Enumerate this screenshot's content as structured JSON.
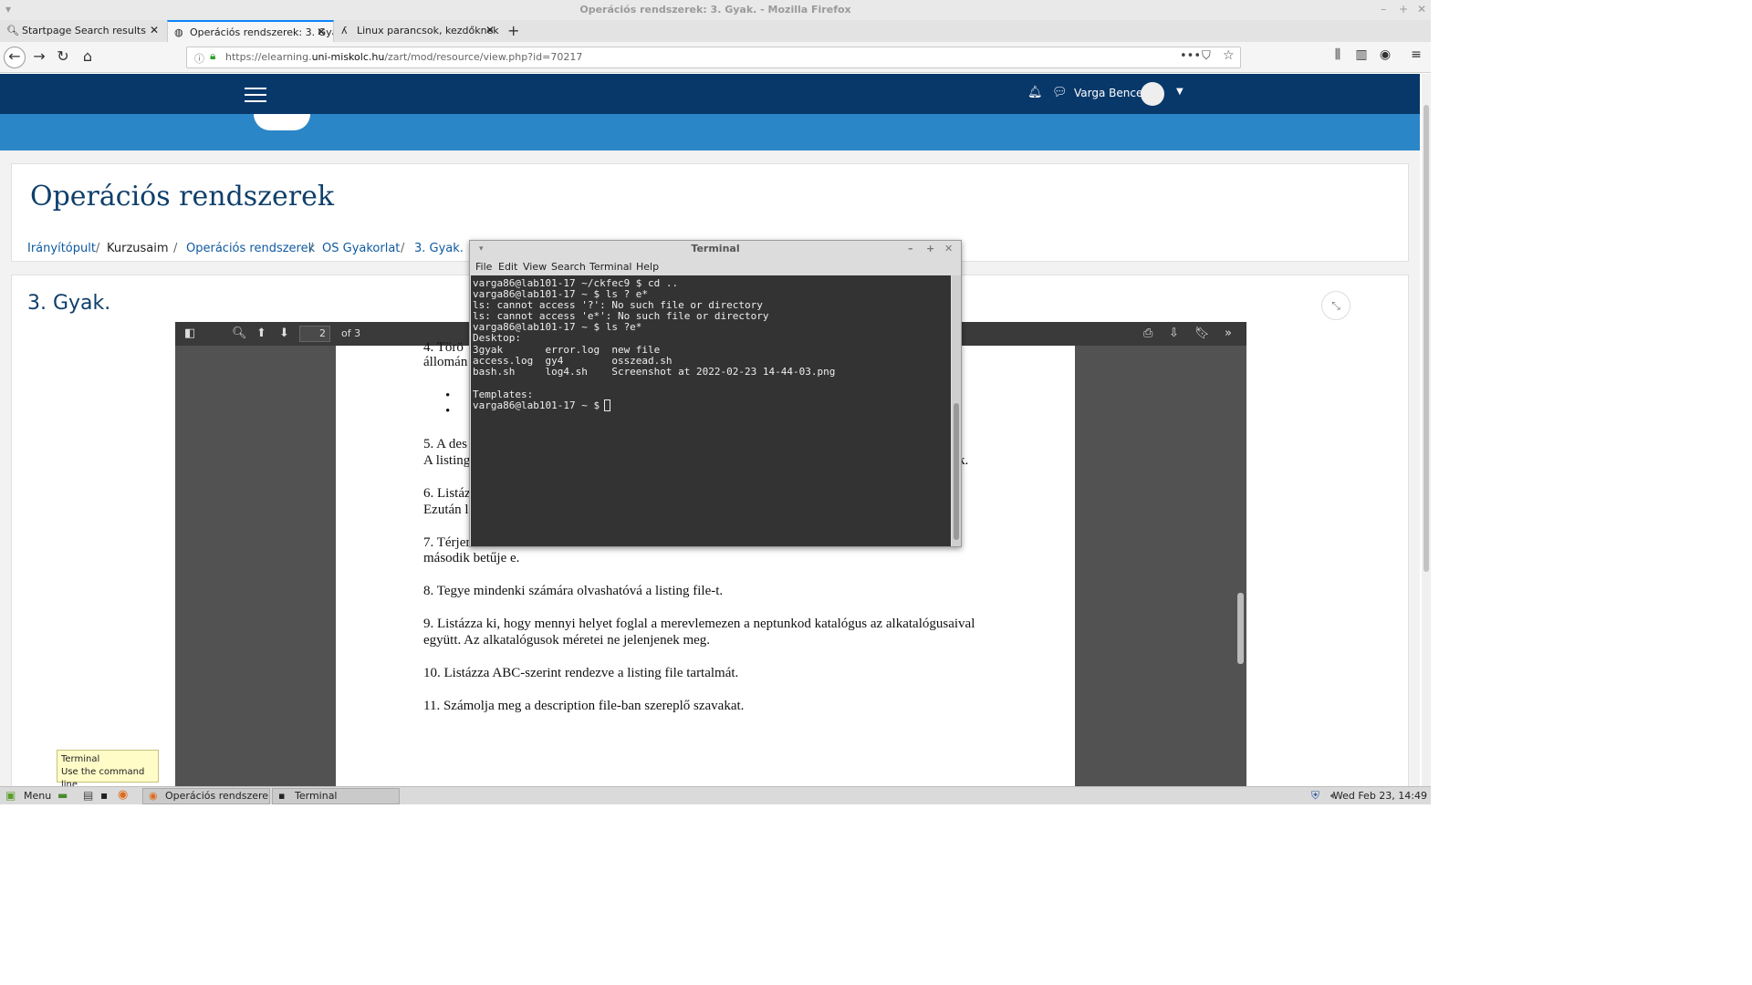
{
  "window": {
    "title": "Operációs rendszerek: 3. Gyak. - Mozilla Firefox"
  },
  "tabs": [
    {
      "label": "Startpage Search results"
    },
    {
      "label": "Operációs rendszerek: 3. Gya"
    },
    {
      "label": "Linux parancsok, kezdőknek"
    }
  ],
  "url": {
    "prefix": "https://elearning.",
    "domain": "uni-miskolc.hu",
    "path": "/zart/mod/resource/view.php?id=70217"
  },
  "header": {
    "user": "Varga Bence"
  },
  "course": {
    "title": "Operációs rendszerek",
    "breadcrumb": [
      "Irányítópult",
      "Kurzusaim",
      "Operációs rendszerek",
      "OS Gyakorlat",
      "3. Gyak."
    ],
    "separator": "/",
    "section_title": "3. Gyak."
  },
  "pdf": {
    "page": "2",
    "of": "of 3",
    "lines": [
      "4. Törö",
      "állomán",
      "•",
      "•",
      "5. A des",
      "A listing",
      "6. Listáz",
      "Ezután l",
      "7. Térjer",
      "második betűje e.",
      "8. Tegye mindenki számára olvashatóvá a listing file-t.",
      "9. Listázza ki, hogy mennyi helyet foglal a merevlemezen a neptunkod katalógus az alkatalógusaival",
      "együtt. Az alkatalógusok méretei ne jelenjenek meg.",
      "10. Listázza ABC-szerint rendezve a listing  file tartalmát.",
      "11. Számolja meg a description file-ban szereplő szavakat.",
      "k."
    ]
  },
  "terminal": {
    "title": "Terminal",
    "menu": [
      "File",
      "Edit",
      "View",
      "Search",
      "Terminal",
      "Help"
    ],
    "lines": [
      "varga86@lab101-17 ~/ckfec9 $ cd ..",
      "varga86@lab101-17 ~ $ ls ? e*",
      "ls: cannot access '?': No such file or directory",
      "ls: cannot access 'e*': No such file or directory",
      "varga86@lab101-17 ~ $ ls ?e*",
      "Desktop:",
      "3gyak       error.log  new file",
      "access.log  gy4        osszead.sh",
      "bash.sh     log4.sh    Screenshot at 2022-02-23 14-44-03.png",
      "",
      "Templates:",
      "varga86@lab101-17 ~ $ "
    ]
  },
  "tooltip": {
    "title": "Terminal",
    "desc": "Use the command line"
  },
  "taskbar": {
    "menu": "Menu",
    "tasks": [
      "Operációs rendszere...",
      "Terminal"
    ],
    "clock": "Wed Feb 23, 14:49"
  }
}
